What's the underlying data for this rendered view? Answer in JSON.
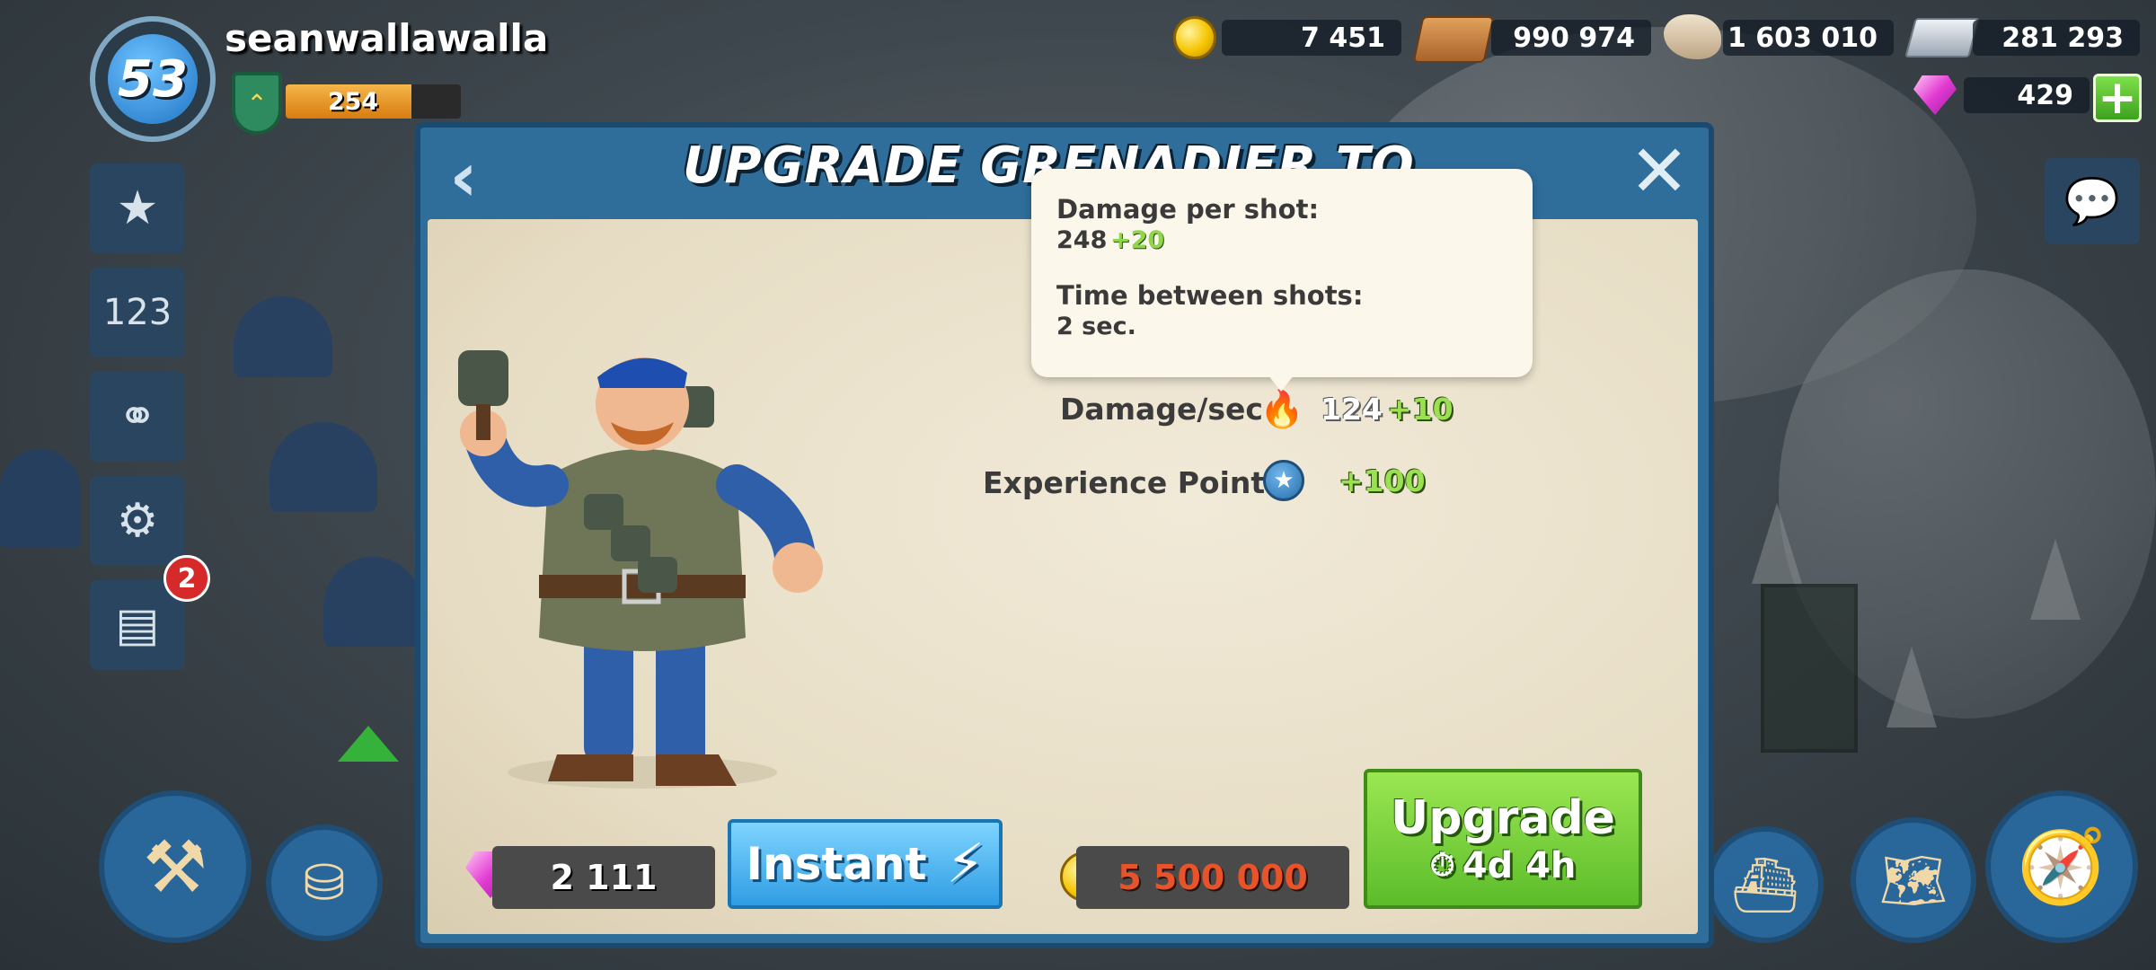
{
  "player": {
    "level": "53",
    "name": "seanwallawalla",
    "xp": "254",
    "xp_fraction": 0.72
  },
  "resources": {
    "gold": "7 451",
    "wood": "990 974",
    "stone": "1 603 010",
    "iron": "281 293",
    "diamonds": "429"
  },
  "sidebar": {
    "reports_badge": "2"
  },
  "dialog": {
    "title": "UPGRADE GRENADIER TO LEVEL 5",
    "stats": [
      {
        "label": "Damage/sec",
        "value": "124",
        "bonus": "+10",
        "icon": "fire-icon"
      },
      {
        "label": "Experience Points",
        "value": "",
        "bonus": "+100",
        "icon": "star-icon"
      }
    ],
    "tooltip": {
      "damage_label": "Damage per shot:",
      "damage_value": "248",
      "damage_bonus": "+20",
      "time_label": "Time between shots:",
      "time_value": "2 sec."
    },
    "diamond_cost": "2 111",
    "instant_label": "Instant",
    "gold_cost": "5 500 000",
    "upgrade_label": "Upgrade",
    "upgrade_time": "4d 4h"
  },
  "colors": {
    "accent_green": "#5cbc2a",
    "accent_blue": "#2f9de3",
    "gold_cost": "#e8532a"
  }
}
